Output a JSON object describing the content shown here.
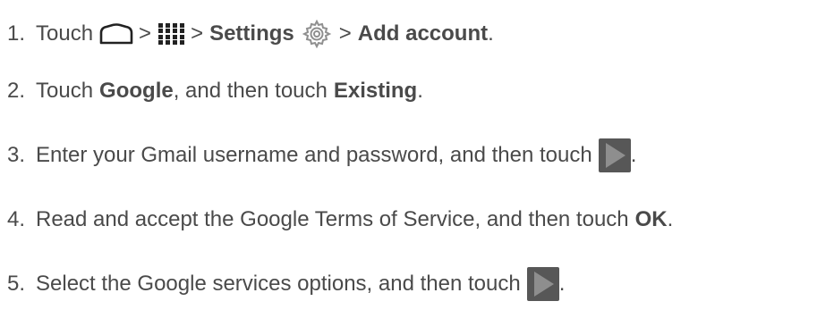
{
  "steps": [
    {
      "number": "1.",
      "parts": {
        "touch": "Touch",
        "sep1": ">",
        "sep2": ">",
        "settings": "Settings",
        "sep3": ">",
        "add_account": "Add account",
        "end": "."
      },
      "icons": [
        "home-icon",
        "apps-icon",
        "gear-icon"
      ]
    },
    {
      "number": "2.",
      "parts": {
        "touch": "Touch",
        "google": "Google",
        "middle": ", and then touch",
        "existing": "Existing",
        "end": "."
      }
    },
    {
      "number": "3.",
      "parts": {
        "text": "Enter your Gmail username and password, and then touch",
        "end": "."
      },
      "icons": [
        "next-arrow-icon"
      ]
    },
    {
      "number": "4.",
      "parts": {
        "text": "Read and accept the Google Terms of Service, and then touch",
        "ok": "OK",
        "end": "."
      }
    },
    {
      "number": "5.",
      "parts": {
        "text": "Select the Google services options, and then touch",
        "end": "."
      },
      "icons": [
        "next-arrow-icon"
      ]
    }
  ]
}
